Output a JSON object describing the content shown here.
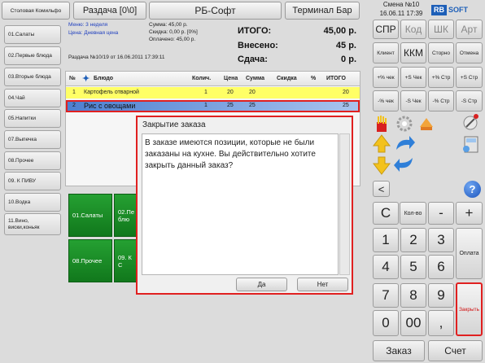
{
  "top_bar": {
    "store_label": "Столовая Комильфо",
    "dispatch_label": "Раздача [0\\0]",
    "app_title": "РБ-Софт",
    "terminal_label": "Терминал Бар",
    "shift_label": "Смена №10",
    "datetime": "16.06.11 17:39",
    "logo_rb": "RB",
    "logo_soft": "SOFT"
  },
  "order_info": {
    "menu_label": "Меню: 3 неделя",
    "price_label": "Цена: Дневная цена",
    "sum_label": "Сумма: 45,00 р.",
    "discount_label": "Скидка: 0,00 р. [0%]",
    "paid_label": "Оплачено: 45,00 р.",
    "order_line": "Раздача №10/19 от 16.06.2011 17:39:11",
    "total_label": "ИТОГО:",
    "total_value": "45,00 р.",
    "deposited_label": "Внесено:",
    "deposited_value": "45 р.",
    "change_label": "Сдача:",
    "change_value": "0 р."
  },
  "categories": [
    {
      "label": "01.Салаты"
    },
    {
      "label": "02.Первые блюда"
    },
    {
      "label": "03.Вторые блюда"
    },
    {
      "label": "04.Чай"
    },
    {
      "label": "05.Напитки"
    },
    {
      "label": "07.Выпечка"
    },
    {
      "label": "08.Прочее"
    },
    {
      "label": "09. К ПИВУ"
    },
    {
      "label": "10.Водка"
    },
    {
      "label": "11.Вино, виски,коньяк"
    }
  ],
  "green_tiles": [
    {
      "label": "01.Салаты"
    },
    {
      "label": "02.Пе блю"
    },
    {
      "label": "08.Прочее"
    },
    {
      "label": "09. К С"
    }
  ],
  "table": {
    "headers": [
      "№",
      "Блюдо",
      "Колич.",
      "Цена",
      "Сумма",
      "Скидка",
      "%",
      "ИТОГО"
    ],
    "rows": [
      {
        "no": "1",
        "dish": "Картофель отварной",
        "qty": "1",
        "price": "20",
        "sum": "20",
        "discount": "",
        "pct": "",
        "total": "20"
      },
      {
        "no": "2",
        "dish": "Рис с овощами",
        "qty": "1",
        "price": "25",
        "sum": "25",
        "discount": "",
        "pct": "",
        "total": "25"
      }
    ]
  },
  "dialog": {
    "title": "Закрытие заказа",
    "message": "В заказе имеются позиции, которые не были заказаны на кухне. Вы действительно хотите закрыть данный заказ?",
    "yes_label": "Да",
    "no_label": "Нет"
  },
  "right_panel": {
    "top_buttons": [
      "СПР",
      "Код",
      "ШК",
      "Арт"
    ],
    "row2": [
      "Клиент",
      "ККМ",
      "Сторно",
      "Отмена"
    ],
    "row3": [
      "+% чек",
      "+S Чек",
      "+% Стр",
      "+S Стр"
    ],
    "row4": [
      "-% чек",
      "-S Чек",
      "-% Стр",
      "-S Стр"
    ],
    "back_label": "<",
    "help_label": "?",
    "keypad": {
      "c": "C",
      "qty": "Кол-во",
      "minus": "-",
      "plus": "+",
      "n1": "1",
      "n2": "2",
      "n3": "3",
      "n4": "4",
      "n5": "5",
      "n6": "6",
      "n7": "7",
      "n8": "8",
      "n9": "9",
      "n0": "0",
      "n00": "00",
      "comma": ",",
      "pay": "Оплата",
      "close": "Закрыть"
    },
    "order_label": "Заказ",
    "bill_label": "Счет"
  },
  "colors": {
    "highlight_row": "#ffff66",
    "selected_row": "#5b8ed8",
    "red_border": "#e02020",
    "green_tile": "#1a8c28",
    "blue_text": "#1f3fbf"
  }
}
